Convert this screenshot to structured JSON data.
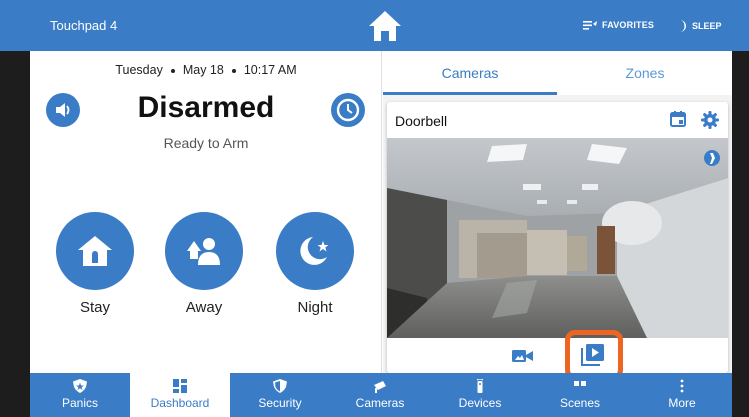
{
  "topbar": {
    "device_name": "Touchpad 4",
    "favorites_label": "FAVORITES",
    "sleep_label": "SLEEP"
  },
  "dashboard": {
    "day": "Tuesday",
    "date": "May 18",
    "time": "10:17 AM",
    "status": "Disarmed",
    "status_sub": "Ready to Arm",
    "arm_modes": [
      {
        "label": "Stay"
      },
      {
        "label": "Away"
      },
      {
        "label": "Night"
      }
    ]
  },
  "right": {
    "tabs": [
      "Cameras",
      "Zones"
    ],
    "active_tab": "Cameras",
    "camera_name": "Doorbell"
  },
  "bottomnav": {
    "items": [
      "Panics",
      "Dashboard",
      "Security",
      "Cameras",
      "Devices",
      "Scenes",
      "More"
    ],
    "active": "Dashboard"
  },
  "colors": {
    "brand_blue": "#3a7cc5",
    "highlight_orange": "#ee6422"
  },
  "icons": [
    "home-icon",
    "favorites-icon",
    "moon-icon",
    "volume-icon",
    "clock-icon",
    "house-icon",
    "people-icon",
    "night-moon-icon",
    "calendar-icon",
    "gear-icon",
    "video-camera-icon",
    "playback-icon",
    "shield-star-icon",
    "dashboard-grid-icon",
    "shield-icon",
    "security-camera-icon",
    "remote-icon",
    "scenes-icon",
    "more-dots-icon"
  ]
}
